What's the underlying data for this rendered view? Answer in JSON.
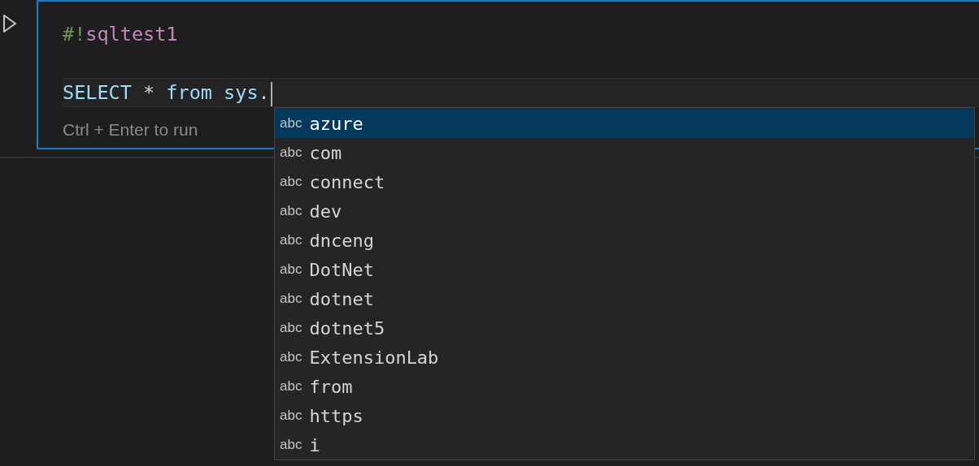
{
  "cell": {
    "focused": true,
    "lines": [
      {
        "current": false,
        "cursor": false,
        "tokens": [
          {
            "kind": "shebang",
            "text": "#!"
          },
          {
            "kind": "kernel",
            "text": "sqltest1"
          }
        ]
      },
      {
        "current": true,
        "cursor": true,
        "tokens": [
          {
            "kind": "keyword",
            "text": "SELECT"
          },
          {
            "kind": "operator",
            "text": " * "
          },
          {
            "kind": "identifier",
            "text": "from sys."
          }
        ]
      }
    ],
    "hint": "Ctrl + Enter to run"
  },
  "suggestions": [
    {
      "icon": "abc",
      "label": "azure",
      "selected": true
    },
    {
      "icon": "abc",
      "label": "com",
      "selected": false
    },
    {
      "icon": "abc",
      "label": "connect",
      "selected": false
    },
    {
      "icon": "abc",
      "label": "dev",
      "selected": false
    },
    {
      "icon": "abc",
      "label": "dnceng",
      "selected": false
    },
    {
      "icon": "abc",
      "label": "DotNet",
      "selected": false
    },
    {
      "icon": "abc",
      "label": "dotnet",
      "selected": false
    },
    {
      "icon": "abc",
      "label": "dotnet5",
      "selected": false
    },
    {
      "icon": "abc",
      "label": "ExtensionLab",
      "selected": false
    },
    {
      "icon": "abc",
      "label": "from",
      "selected": false
    },
    {
      "icon": "abc",
      "label": "https",
      "selected": false
    },
    {
      "icon": "abc",
      "label": "i",
      "selected": false
    }
  ]
}
